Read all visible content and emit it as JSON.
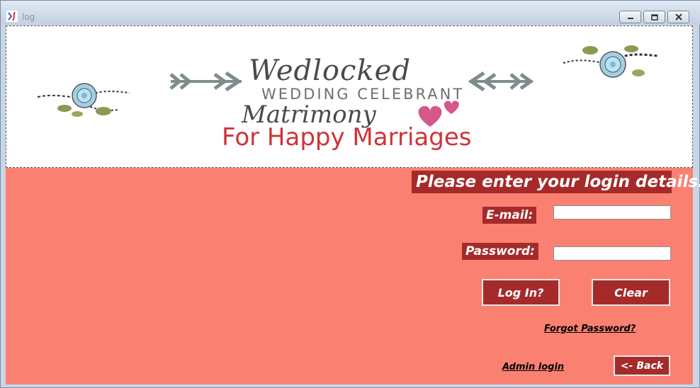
{
  "window": {
    "title": "log",
    "controls": {
      "minimize": "minimize-icon",
      "maximize": "maximize-icon",
      "close": "close-icon"
    }
  },
  "banner": {
    "brand": "Wedlocked",
    "subtitle": "WEDDING CELEBRANT",
    "name": "Matrimony",
    "tagline": "For Happy Marriages"
  },
  "form": {
    "heading": "Please enter your login details:-",
    "email_label": "E-mail:",
    "email_value": "",
    "password_label": "Password:",
    "password_value": "",
    "login_button": "Log In?",
    "clear_button": "Clear",
    "forgot_link": "Forgot Password?",
    "admin_link": "Admin login",
    "back_button": "<- Back"
  },
  "colors": {
    "background": "#fa8072",
    "accent": "#a52a2a",
    "tagline": "#cf3339",
    "heart": "#d6578a"
  }
}
